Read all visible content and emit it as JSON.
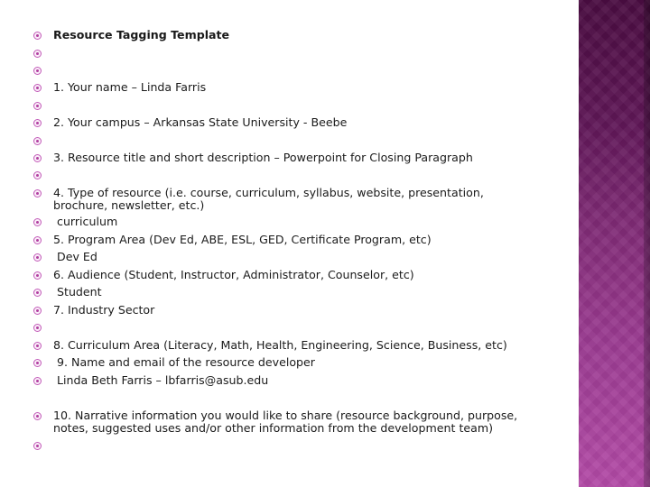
{
  "slide": {
    "title": "Resource Tagging Template",
    "bullet_icon": "circled-dot",
    "accent_color": "#b0409f",
    "panel_gradient": [
      "#4a0c41",
      "#b24aa6"
    ],
    "items": [
      {
        "text": "Resource Tagging Template",
        "bold": true
      },
      {
        "text": ""
      },
      {
        "text": ""
      },
      {
        "text": "1. Your name – Linda Farris"
      },
      {
        "text": ""
      },
      {
        "text": "2. Your campus – Arkansas State University - Beebe"
      },
      {
        "text": ""
      },
      {
        "text": "3. Resource title and short description – Powerpoint for Closing Paragraph"
      },
      {
        "text": ""
      },
      {
        "text": "4. Type of resource (i.e. course, curriculum, syllabus, website, presentation, brochure, newsletter, etc.)"
      },
      {
        "text": " curriculum"
      },
      {
        "text": "5. Program Area (Dev Ed, ABE, ESL, GED, Certificate Program, etc)"
      },
      {
        "text": " Dev Ed"
      },
      {
        "text": "6. Audience (Student, Instructor, Administrator, Counselor, etc)"
      },
      {
        "text": " Student"
      },
      {
        "text": "7. Industry Sector"
      },
      {
        "text": ""
      },
      {
        "text": "8. Curriculum Area (Literacy, Math, Health, Engineering, Science, Business, etc)"
      },
      {
        "text": " 9. Name and email of the resource developer"
      },
      {
        "text": " Linda Beth Farris – lbfarris@asub.edu"
      },
      {
        "text": "10. Narrative information you would like to share (resource background, purpose, notes, suggested uses and/or other information from the development team)"
      },
      {
        "text": ""
      }
    ]
  }
}
